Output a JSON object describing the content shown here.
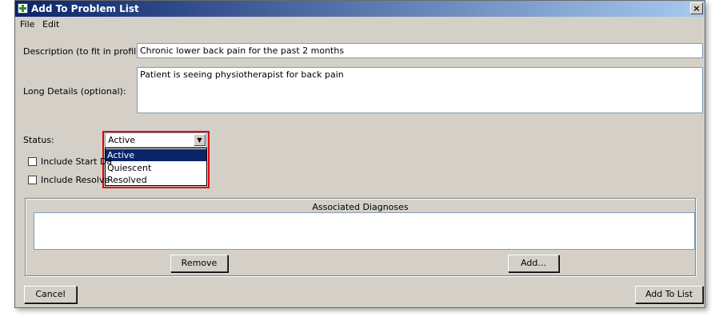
{
  "window": {
    "title": "Add To Problem List"
  },
  "menu": {
    "file": "File",
    "edit": "Edit"
  },
  "form": {
    "description_label": "Description (to fit in profile):",
    "description_value": "Chronic lower back pain for the past 2 months",
    "long_details_label": "Long Details (optional):",
    "long_details_value": "Patient is seeing physiotherapist for back pain",
    "status_label": "Status:",
    "status_value": "Active",
    "status_options": [
      "Active",
      "Quiescent",
      "Resolved"
    ],
    "include_start_label": "Include Start Da",
    "include_resolved_label": "Include Resolve"
  },
  "diagnoses": {
    "title": "Associated Diagnoses",
    "remove_label": "Remove",
    "add_label": "Add..."
  },
  "footer": {
    "cancel_label": "Cancel",
    "add_to_list_label": "Add To List"
  },
  "colors": {
    "titlebar_start": "#0a246a",
    "titlebar_end": "#a6caf0",
    "highlight": "#e00000",
    "selection": "#0a246a"
  }
}
